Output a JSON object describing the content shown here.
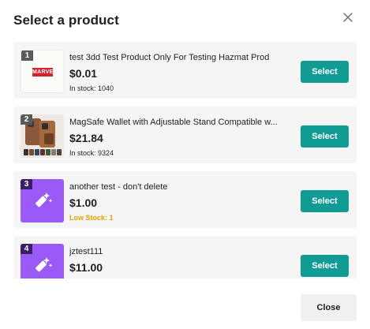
{
  "dialog": {
    "title": "Select a product",
    "close_label": "Close",
    "colors": {
      "accent": "#109b94",
      "low_stock": "#e6a000",
      "placeholder": "#9b59f5"
    }
  },
  "products": [
    {
      "index": "1",
      "name": "test 3dd Test Product Only For Testing Hazmat Prod",
      "price": "$0.01",
      "stock": "In stock: 1040",
      "stock_level": "normal",
      "select_label": "Select",
      "thumb": "marvel-image",
      "thumb_text": "MARVEL"
    },
    {
      "index": "2",
      "name": "MagSafe Wallet with Adjustable Stand Compatible w...",
      "price": "$21.84",
      "stock": "In stock: 9324",
      "stock_level": "normal",
      "select_label": "Select",
      "thumb": "wallet-image"
    },
    {
      "index": "3",
      "name": "another test - don't delete",
      "price": "$1.00",
      "stock": "Low Stock: 1",
      "stock_level": "low",
      "select_label": "Select",
      "thumb": "magic-wand-icon"
    },
    {
      "index": "4",
      "name": "jztest111",
      "price": "$11.00",
      "stock": "",
      "stock_level": "normal",
      "select_label": "Select",
      "thumb": "magic-wand-icon"
    }
  ]
}
